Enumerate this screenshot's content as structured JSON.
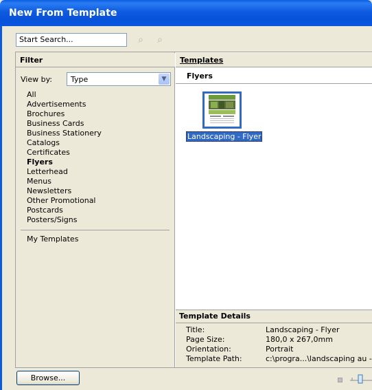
{
  "window": {
    "title": "New From Template"
  },
  "search": {
    "value": "Start Search...",
    "search_icon": "search-icon",
    "advanced_search_icon": "search-icon"
  },
  "filter": {
    "header": "Filter",
    "view_by_label": "View by:",
    "view_by_value": "Type",
    "types": [
      "All",
      "Advertisements",
      "Brochures",
      "Business Cards",
      "Business Stationery",
      "Catalogs",
      "Certificates",
      "Flyers",
      "Letterhead",
      "Menus",
      "Newsletters",
      "Other Promotional",
      "Postcards",
      "Posters/Signs"
    ],
    "selected_type": "Flyers",
    "my_templates": "My Templates"
  },
  "templates": {
    "header": "Templates",
    "section": "Flyers",
    "items": [
      {
        "label": "Landscaping - Flyer",
        "selected": true
      }
    ]
  },
  "details": {
    "header": "Template Details",
    "rows": [
      {
        "key": "Title:",
        "value": "Landscaping - Flyer"
      },
      {
        "key": "Page Size:",
        "value": "180,0 x 267,0mm"
      },
      {
        "key": "Orientation:",
        "value": "Portrait"
      },
      {
        "key": "Template Path:",
        "value": "c:\\progra...\\landscaping au -"
      }
    ]
  },
  "footer": {
    "browse_label": "Browse..."
  },
  "colors": {
    "title_bar": "#0a5ee0",
    "selection": "#316ac5",
    "panel": "#ece9d8"
  }
}
